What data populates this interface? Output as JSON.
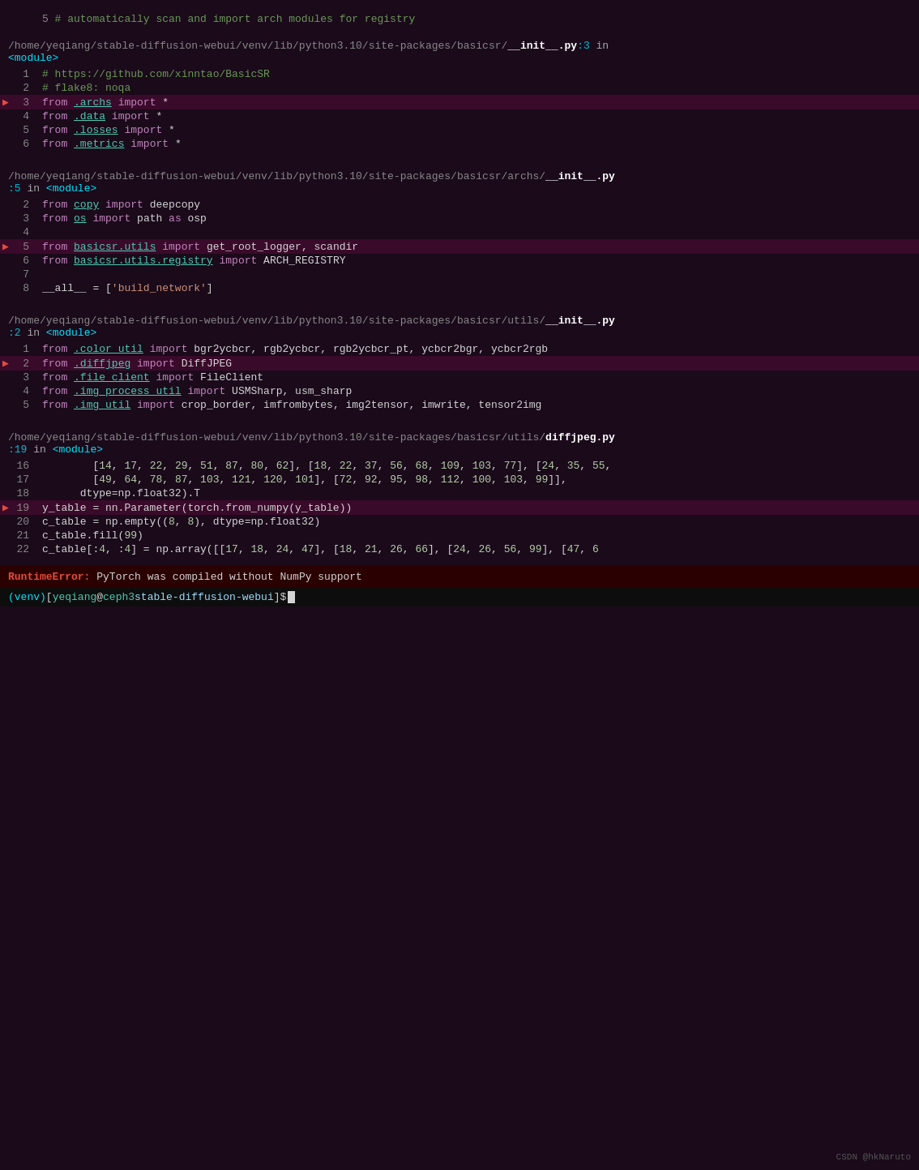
{
  "terminal": {
    "top_comment": "5 # automatically scan and import arch modules for registry",
    "sections": [
      {
        "filepath": "/home/yeqiang/stable-diffusion-webui/venv/lib/python3.10/site-packages/basicsr/",
        "filename": "__init__.py",
        "line_ref": ":3",
        "suffix": " in ",
        "module": "<module>",
        "lines": [
          {
            "num": 1,
            "content": "# https://github.com/xinntao/BasicSR",
            "type": "comment",
            "active": false
          },
          {
            "num": 2,
            "content": "# flake8: noqa",
            "type": "comment",
            "active": false
          },
          {
            "num": 3,
            "content": "from .archs import *",
            "type": "import_link",
            "active": true,
            "link_text": ".archs"
          },
          {
            "num": 4,
            "content": "from .data import *",
            "type": "import_link",
            "active": false,
            "link_text": ".data"
          },
          {
            "num": 5,
            "content": "from .losses import *",
            "type": "import_link",
            "active": false,
            "link_text": ".losses"
          },
          {
            "num": 6,
            "content": "from .metrics import *",
            "type": "import_link",
            "active": false,
            "link_text": ".metrics"
          }
        ]
      },
      {
        "filepath": "/home/yeqiang/stable-diffusion-webui/venv/lib/python3.10/site-packages/basicsr/archs/",
        "filename": "__init__.py",
        "line_ref": ":5",
        "suffix": " in ",
        "module": "<module>",
        "lines": [
          {
            "num": 2,
            "content": "from copy import deepcopy",
            "type": "import_link",
            "active": false,
            "link_text": "copy"
          },
          {
            "num": 3,
            "content": "from os import path as osp",
            "type": "import_link",
            "active": false,
            "link_text": "os"
          },
          {
            "num": 4,
            "content": "",
            "type": "empty",
            "active": false
          },
          {
            "num": 5,
            "content": "from basicsr.utils import get_root_logger, scandir",
            "type": "import_link",
            "active": true,
            "link_text": "basicsr.utils"
          },
          {
            "num": 6,
            "content": "from basicsr.utils.registry import ARCH_REGISTRY",
            "type": "import_link",
            "active": false,
            "link_text": "basicsr.utils.registry"
          },
          {
            "num": 7,
            "content": "",
            "type": "empty",
            "active": false
          },
          {
            "num": 8,
            "content": "__all__ = ['build_network']",
            "type": "code",
            "active": false
          }
        ]
      },
      {
        "filepath": "/home/yeqiang/stable-diffusion-webui/venv/lib/python3.10/site-packages/basicsr/utils/",
        "filename": "__init__.py",
        "line_ref": ":2",
        "suffix": " in ",
        "module": "<module>",
        "lines": [
          {
            "num": 1,
            "content": "from .color_util import bgr2ycbcr, rgb2ycbcr, rgb2ycbcr_pt, ycbcr2bgr, ycbcr2rgb",
            "type": "import_link",
            "active": false,
            "link_text": ".color_util"
          },
          {
            "num": 2,
            "content": "from .diffjpeg import DiffJPEG",
            "type": "import_link",
            "active": true,
            "link_text": ".diffjpeg"
          },
          {
            "num": 3,
            "content": "from .file_client import FileClient",
            "type": "import_link",
            "active": false,
            "link_text": ".file_client"
          },
          {
            "num": 4,
            "content": "from .img_process_util import USMSharp, usm_sharp",
            "type": "import_link",
            "active": false,
            "link_text": ".img_process_util"
          },
          {
            "num": 5,
            "content": "from .img_util import crop_border, imfrombytes, img2tensor, imwrite, tensor2img",
            "type": "import_link",
            "active": false,
            "link_text": ".img_util"
          }
        ]
      },
      {
        "filepath": "/home/yeqiang/stable-diffusion-webui/venv/lib/python3.10/site-packages/basicsr/utils/",
        "filename": "diffjpeg.py",
        "line_ref": ":19",
        "suffix": " in ",
        "module": "<module>",
        "lines": [
          {
            "num": 16,
            "content": "        [14, 17, 22, 29, 51, 87, 80, 62], [18, 22, 37, 56, 68, 109, 103, 77], [24, 35, 55,",
            "type": "numbers",
            "active": false
          },
          {
            "num": 17,
            "content": "        [49, 64, 78, 87, 103, 121, 120, 101], [72, 92, 95, 98, 112, 100, 103, 99]],",
            "type": "numbers",
            "active": false
          },
          {
            "num": 18,
            "content": "      dtype=np.float32).T",
            "type": "code",
            "active": false
          },
          {
            "num": 19,
            "content": "y_table = nn.Parameter(torch.from_numpy(y_table))",
            "type": "code",
            "active": true
          },
          {
            "num": 20,
            "content": "c_table = np.empty((8, 8), dtype=np.float32)",
            "type": "code_numbers",
            "active": false
          },
          {
            "num": 21,
            "content": "c_table.fill(99)",
            "type": "code_numbers",
            "active": false
          },
          {
            "num": 22,
            "content": "c_table[:4, :4] = np.array([[17, 18, 24, 47], [18, 21, 26, 66], [24, 26, 56, 99], [47, 6",
            "type": "code_numbers",
            "active": false
          }
        ]
      }
    ],
    "error": {
      "text": "RuntimeError: PyTorch was compiled without NumPy support"
    },
    "prompt": {
      "env": "(venv)",
      "user": "yeqiang",
      "host": "ceph3",
      "path": "stable-diffusion-webui",
      "dollar": "$"
    },
    "watermark": "CSDN @hkNaruto"
  }
}
